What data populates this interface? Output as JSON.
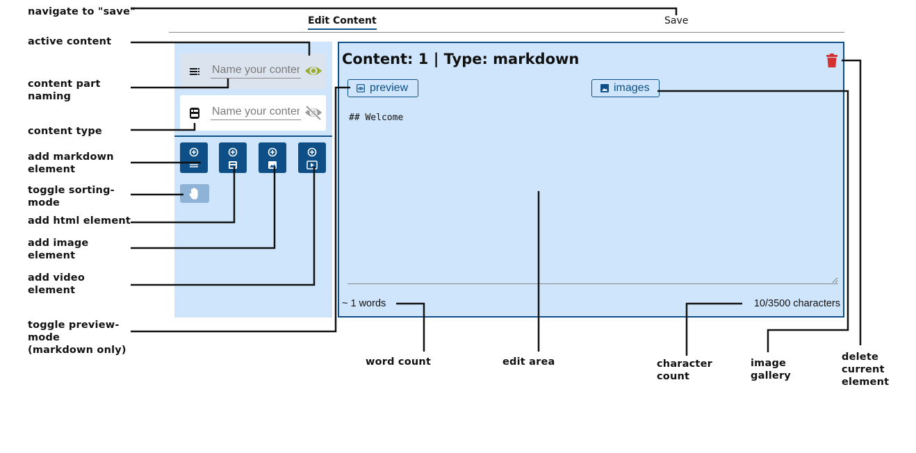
{
  "tabs": {
    "edit": "Edit Content",
    "save": "Save"
  },
  "sidebar": {
    "parts": [
      {
        "placeholder": "Name your content",
        "type_icon": "markdown-icon",
        "visibility": "visible"
      },
      {
        "placeholder": "Name your content",
        "type_icon": "html-icon",
        "visibility": "hidden"
      }
    ],
    "add_buttons": [
      "add-markdown-icon",
      "add-html-icon",
      "add-image-icon",
      "add-video-icon"
    ]
  },
  "panel": {
    "title": "Content: 1 | Type: markdown",
    "preview_label": "preview",
    "images_label": "images",
    "editor_value": "## Welcome",
    "word_count": "~ 1 words",
    "char_count": "10/3500 characters"
  },
  "annotations": {
    "save": "navigate to \"save\"",
    "active": "active content",
    "naming": "content part\nnaming",
    "type": "content type",
    "add_md": "add markdown\nelement",
    "sorting": "toggle sorting-\nmode",
    "add_html": "add html element",
    "add_image": "add image\nelement",
    "add_video": "add video\nelement",
    "preview_mode": "toggle preview-\nmode\n(markdown only)",
    "word_count": "word count",
    "edit_area": "edit area",
    "char_count": "character\ncount",
    "gallery": "image\ngallery",
    "delete": "delete\ncurrent\nelement"
  },
  "colors": {
    "accent": "#0d4f86",
    "panel_bg": "#cfe5fb",
    "eye_active": "#9aab2e",
    "delete": "#d33131"
  }
}
